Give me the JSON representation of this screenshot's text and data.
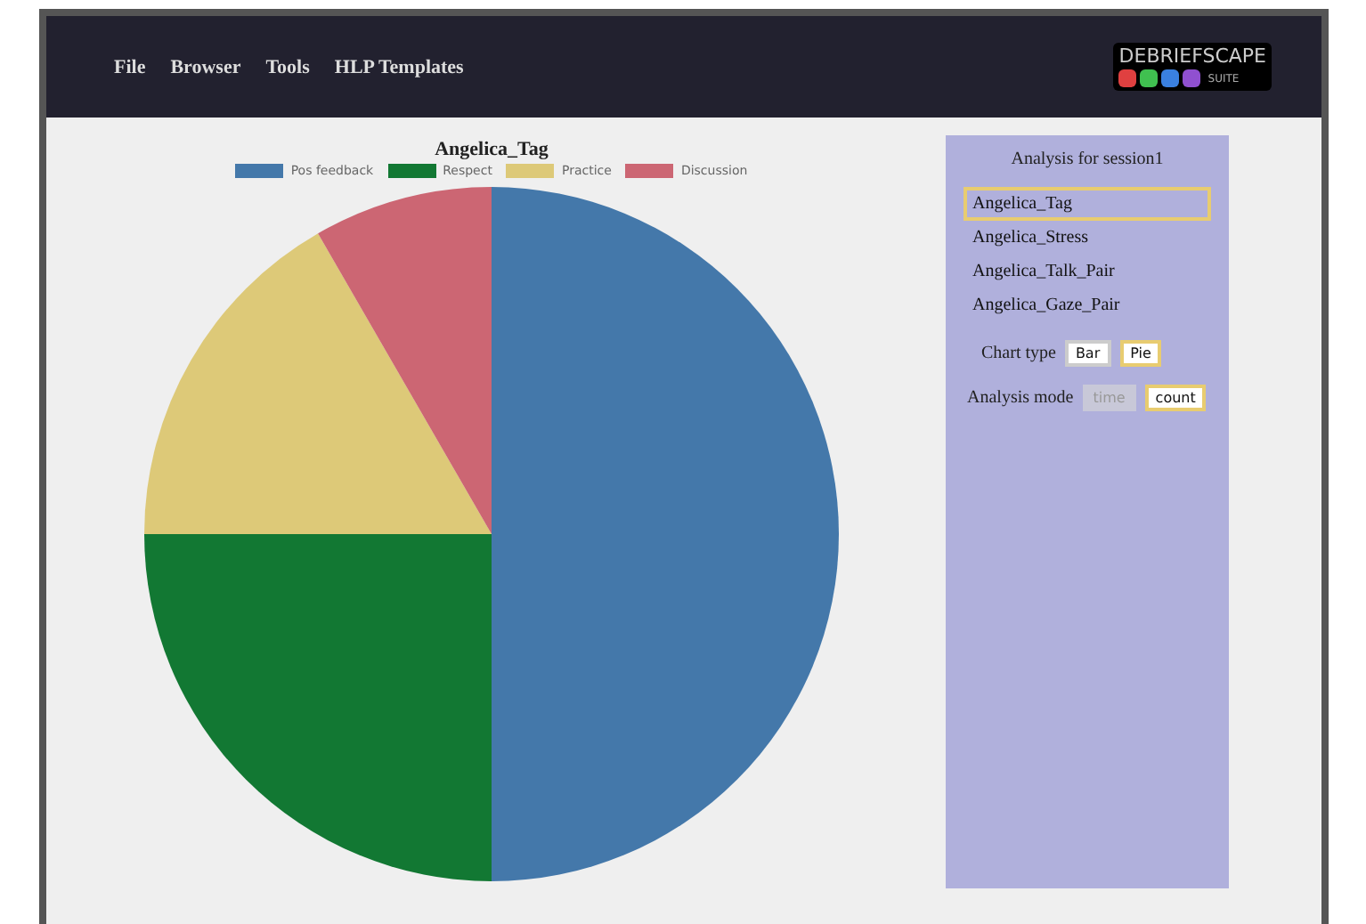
{
  "menu": [
    {
      "label": "File"
    },
    {
      "label": "Browser"
    },
    {
      "label": "Tools"
    },
    {
      "label": "HLP Templates"
    }
  ],
  "logo": {
    "title": "DEBRIEFSCAPE",
    "subtitle": "SUITE"
  },
  "chart": {
    "chart_data": {
      "type": "pie",
      "title": "Angelica_Tag",
      "legend": "top",
      "categories": [
        "Pos feedback",
        "Respect",
        "Practice",
        "Discussion"
      ],
      "values": [
        50,
        25,
        16.67,
        8.33
      ],
      "colors": [
        "#4478aa",
        "#127833",
        "#ddc978",
        "#cc6673"
      ]
    }
  },
  "panel": {
    "title": "Analysis for session1",
    "analyses": [
      {
        "label": "Angelica_Tag",
        "selected": true
      },
      {
        "label": "Angelica_Stress",
        "selected": false
      },
      {
        "label": "Angelica_Talk_Pair",
        "selected": false
      },
      {
        "label": "Angelica_Gaze_Pair",
        "selected": false
      }
    ],
    "chart_type": {
      "label": "Chart type",
      "options": [
        {
          "label": "Bar",
          "selected": false,
          "disabled": false
        },
        {
          "label": "Pie",
          "selected": true,
          "disabled": false
        }
      ]
    },
    "analysis_mode": {
      "label": "Analysis mode",
      "options": [
        {
          "label": "time",
          "selected": false,
          "disabled": true
        },
        {
          "label": "count",
          "selected": true,
          "disabled": false
        }
      ]
    }
  }
}
